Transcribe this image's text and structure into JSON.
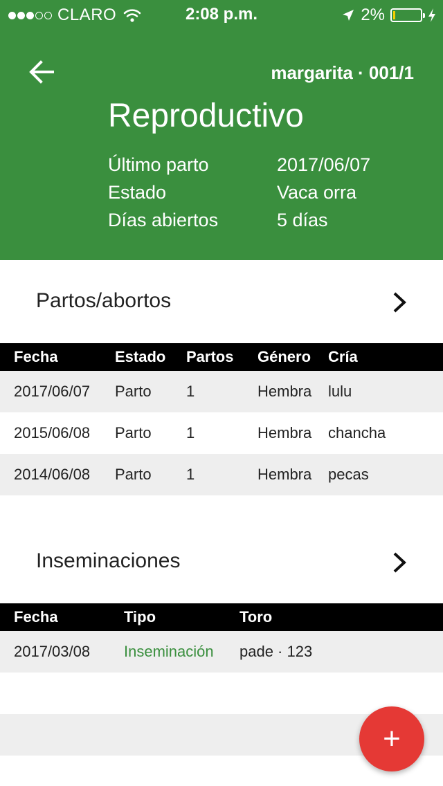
{
  "status_bar": {
    "carrier": "CLARO",
    "time": "2:08 p.m.",
    "battery_percent": "2%",
    "signal_bars_filled": 3,
    "signal_bars_total": 5
  },
  "header": {
    "animal_id": "margarita · 001/1",
    "title": "Reproductivo",
    "info": [
      {
        "label": "Último parto",
        "value": "2017/06/07"
      },
      {
        "label": "Estado",
        "value": "Vaca orra"
      },
      {
        "label": "Días abiertos",
        "value": "5 días"
      }
    ],
    "background_color": "#3a8f3e"
  },
  "partos": {
    "title": "Partos/abortos",
    "columns": [
      "Fecha",
      "Estado",
      "Partos",
      "Género",
      "Cría"
    ],
    "rows": [
      [
        "2017/06/07",
        "Parto",
        "1",
        "Hembra",
        "lulu"
      ],
      [
        "2015/06/08",
        "Parto",
        "1",
        "Hembra",
        "chancha"
      ],
      [
        "2014/06/08",
        "Parto",
        "1",
        "Hembra",
        "pecas"
      ]
    ]
  },
  "inseminaciones": {
    "title": "Inseminaciones",
    "columns": [
      "Fecha",
      "Tipo",
      "Toro"
    ],
    "rows": [
      [
        "2017/03/08",
        "Inseminación",
        "pade · 123"
      ]
    ],
    "type_color": "#3a8f3e"
  },
  "fab": {
    "icon": "plus-icon",
    "color": "#e53935"
  }
}
